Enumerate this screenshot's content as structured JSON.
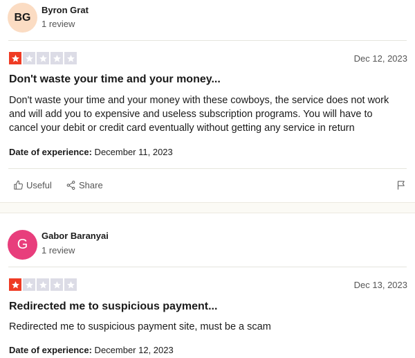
{
  "colors": {
    "star_active": "#ef3b24",
    "star_inactive": "#dcdce6",
    "avatar_bg_1": "#fbdcc3",
    "avatar_bg_2": "#e83e7c"
  },
  "reviews": [
    {
      "avatar_initials": "BG",
      "reviewer_name": "Byron Grat",
      "review_count": "1 review",
      "rating": 1,
      "date": "Dec 12, 2023",
      "title": "Don't waste your time and your money...",
      "body": "Don't waste your time and your money with these cowboys, the service does not work and will add you to expensive and useless subscription programs. You will have to cancel your debit or credit card eventually without getting any service in return",
      "experience_label": "Date of experience:",
      "experience_date": " December 11, 2023",
      "useful_label": "Useful",
      "share_label": "Share",
      "icons": [
        "thumbs-up-icon",
        "share-icon",
        "flag-icon"
      ]
    },
    {
      "avatar_initials": "G",
      "reviewer_name": "Gabor Baranyai",
      "review_count": "1 review",
      "rating": 1,
      "date": "Dec 13, 2023",
      "title": "Redirected me to suspicious payment...",
      "body": "Redirected me to suspicious payment site, must be a scam",
      "experience_label": "Date of experience:",
      "experience_date": " December 12, 2023"
    }
  ]
}
